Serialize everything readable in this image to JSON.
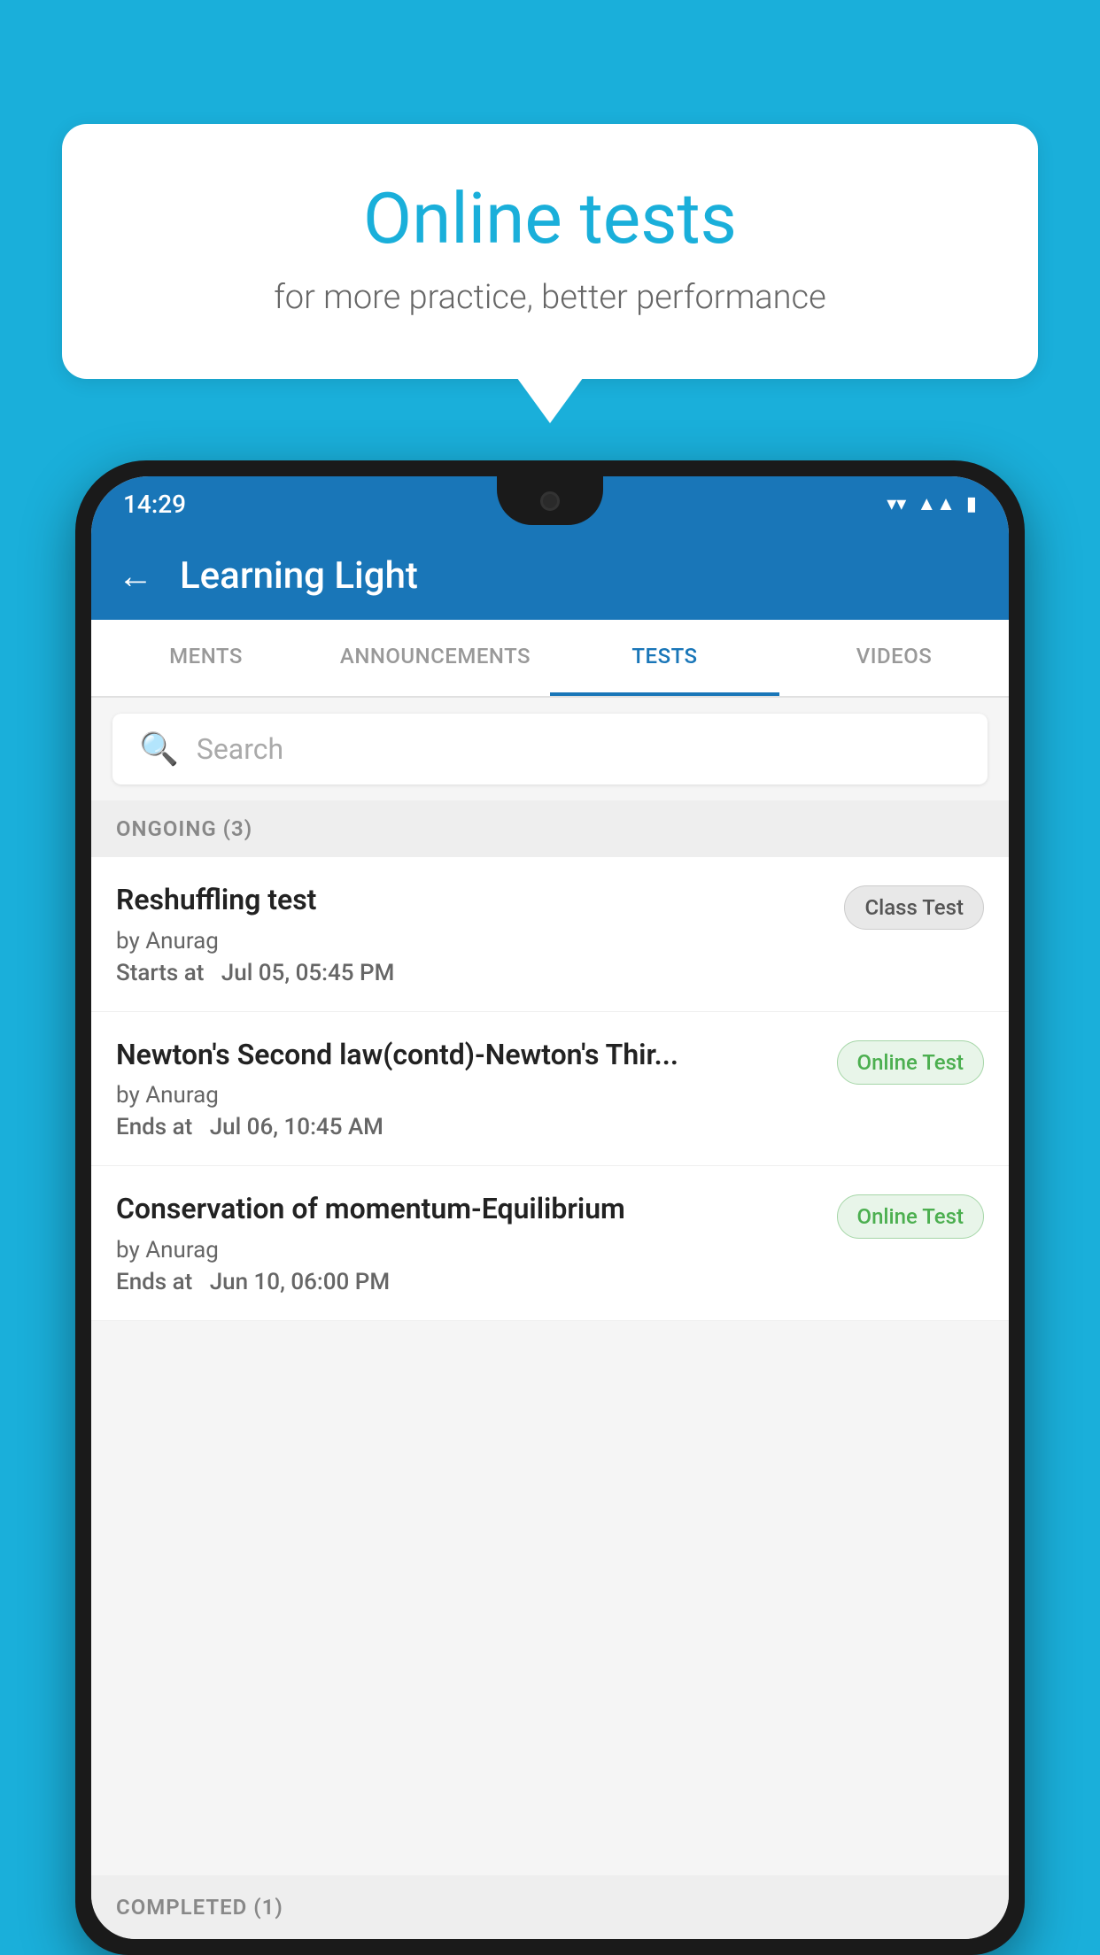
{
  "background_color": "#1AAFDA",
  "speech_bubble": {
    "title": "Online tests",
    "subtitle": "for more practice, better performance"
  },
  "phone": {
    "status_bar": {
      "time": "14:29",
      "icons": [
        "wifi",
        "signal",
        "battery"
      ]
    },
    "app_bar": {
      "title": "Learning Light",
      "back_label": "←"
    },
    "tabs": [
      {
        "label": "MENTS",
        "active": false
      },
      {
        "label": "ANNOUNCEMENTS",
        "active": false
      },
      {
        "label": "TESTS",
        "active": true
      },
      {
        "label": "VIDEOS",
        "active": false
      }
    ],
    "search": {
      "placeholder": "Search"
    },
    "section_ongoing": {
      "label": "ONGOING (3)"
    },
    "ongoing_items": [
      {
        "title": "Reshuffling test",
        "author": "by Anurag",
        "date_label": "Starts at",
        "date_value": "Jul 05, 05:45 PM",
        "tag": "Class Test",
        "tag_type": "class"
      },
      {
        "title": "Newton's Second law(contd)-Newton's Thir...",
        "author": "by Anurag",
        "date_label": "Ends at",
        "date_value": "Jul 06, 10:45 AM",
        "tag": "Online Test",
        "tag_type": "online"
      },
      {
        "title": "Conservation of momentum-Equilibrium",
        "author": "by Anurag",
        "date_label": "Ends at",
        "date_value": "Jun 10, 06:00 PM",
        "tag": "Online Test",
        "tag_type": "online"
      }
    ],
    "section_completed": {
      "label": "COMPLETED (1)"
    }
  }
}
